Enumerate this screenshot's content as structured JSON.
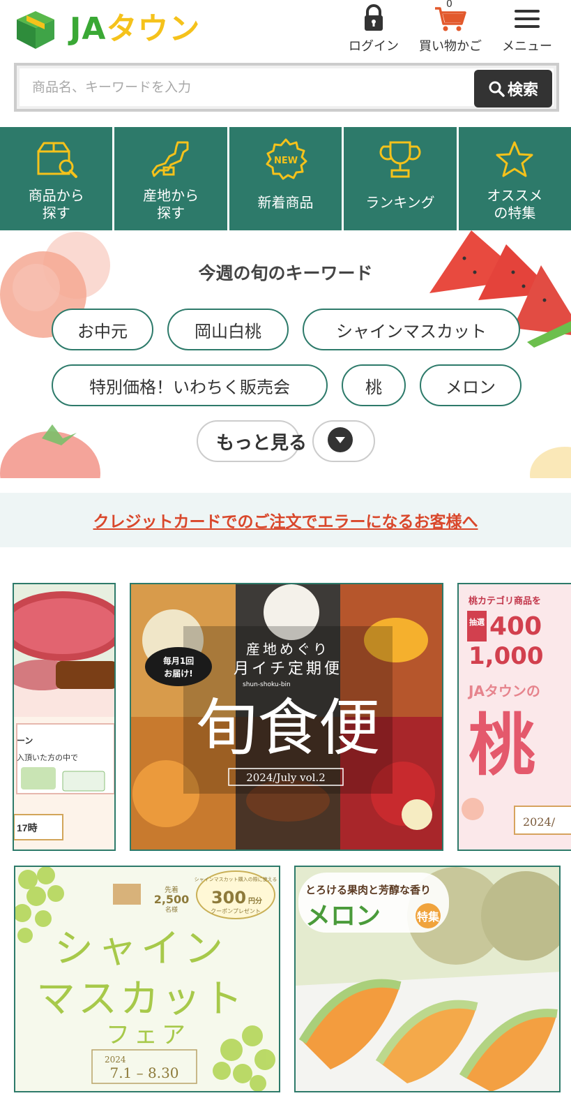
{
  "header": {
    "logo_ja": "JA",
    "logo_town": "タウン",
    "login_label": "ログイン",
    "cart_label": "買い物かご",
    "cart_count": "0",
    "menu_label": "メニュー"
  },
  "search": {
    "placeholder": "商品名、キーワードを入力",
    "button_label": "検索"
  },
  "nav": {
    "items": [
      {
        "label": "商品から\n探す",
        "icon": "box-search-icon"
      },
      {
        "label": "産地から\n探す",
        "icon": "japan-map-icon"
      },
      {
        "label": "新着商品",
        "icon": "new-badge-icon",
        "badge": "NEW"
      },
      {
        "label": "ランキング",
        "icon": "trophy-icon"
      },
      {
        "label": "オススメ\nの特集",
        "icon": "star-icon"
      }
    ]
  },
  "keywords": {
    "title": "今週の旬のキーワード",
    "items": [
      "お中元",
      "岡山白桃",
      "シャインマスカット",
      "特別価格！いわちく販売会",
      "桃",
      "メロン"
    ],
    "more_label": "もっと見る"
  },
  "notice": {
    "text": "クレジットカードでのご注文でエラーになるお客様へ"
  },
  "banners": {
    "left": {
      "line1": "ーン",
      "line2": "入頂いた方の中で",
      "date": "17時"
    },
    "center": {
      "badge_line1": "毎月1回",
      "badge_line2": "お届け!",
      "subtitle": "産地めぐり",
      "subtitle2": "月イチ定期便",
      "romaji": "shun-shoku-bin",
      "title": "旬食便",
      "edition": "2024/July vol.2"
    },
    "right": {
      "top": "桃カテゴリ商品を",
      "lottery": "抽選",
      "num1": "400",
      "num2": "1,000",
      "brand": "JAタウンの",
      "title": "桃",
      "date": "2024/"
    },
    "grape": {
      "title1": "シャイン",
      "title2": "マスカット",
      "title3": "フェア",
      "coupon_pre": "先着",
      "coupon_count": "2,500",
      "coupon_unit": "名様",
      "coupon_desc": "シャインマスカット購入の際に使える",
      "coupon_amount": "300",
      "coupon_yen": "円分",
      "coupon_tail": "クーポンプレゼント",
      "year": "2024",
      "period": "7.1 – 8.30"
    },
    "melon": {
      "tagline": "とろける果肉と芳醇な香り",
      "title": "メロン",
      "tag": "特集"
    }
  },
  "colors": {
    "brand_green": "#2d7a6a",
    "logo_green": "#3aa835",
    "logo_yellow": "#f5c21b",
    "notice_red": "#d9472b"
  }
}
